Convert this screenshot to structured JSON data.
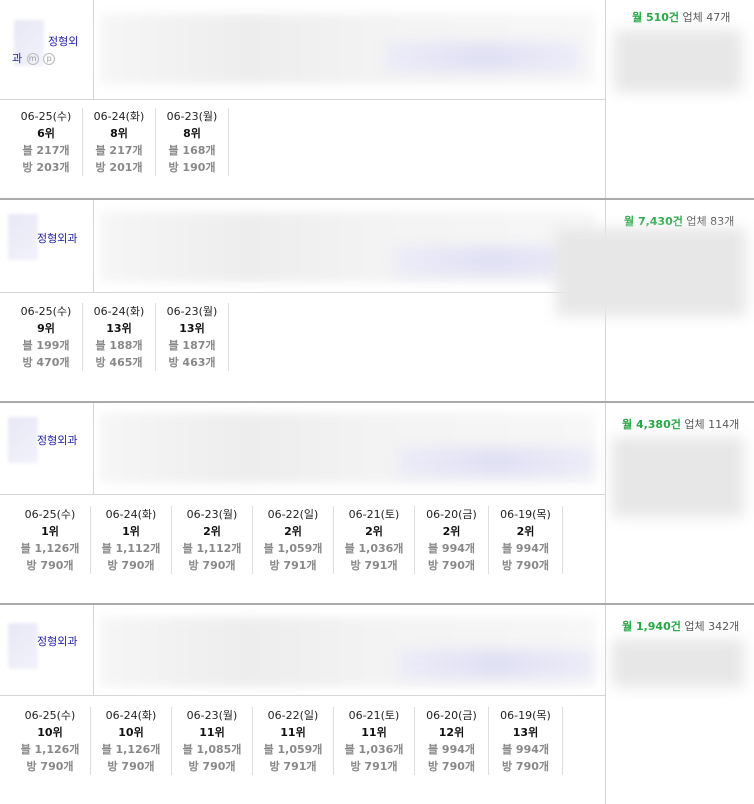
{
  "blocks": [
    {
      "category": "정형외과",
      "category_split": [
        "정형외",
        "과"
      ],
      "badges": [
        "m",
        "p"
      ],
      "stat_month": "월 510건",
      "stat_biz": "업체 47개",
      "days": [
        {
          "date": "06-25(수)",
          "rank": "6위",
          "bul": "블 217개",
          "bang": "방 203개"
        },
        {
          "date": "06-24(화)",
          "rank": "8위",
          "bul": "블 217개",
          "bang": "방 201개"
        },
        {
          "date": "06-23(월)",
          "rank": "8위",
          "bul": "블 168개",
          "bang": "방 190개"
        }
      ]
    },
    {
      "category": "정형외과",
      "stat_month": "월 7,430건",
      "stat_biz": "업체 83개",
      "days": [
        {
          "date": "06-25(수)",
          "rank": "9위",
          "bul": "블 199개",
          "bang": "방 470개"
        },
        {
          "date": "06-24(화)",
          "rank": "13위",
          "bul": "블 188개",
          "bang": "방 465개"
        },
        {
          "date": "06-23(월)",
          "rank": "13위",
          "bul": "블 187개",
          "bang": "방 463개"
        }
      ]
    },
    {
      "category": "정형외과",
      "stat_month": "월 4,380건",
      "stat_biz": "업체 114개",
      "days": [
        {
          "date": "06-25(수)",
          "rank": "1위",
          "bul": "블 1,126개",
          "bang": "방 790개"
        },
        {
          "date": "06-24(화)",
          "rank": "1위",
          "bul": "블 1,112개",
          "bang": "방 790개"
        },
        {
          "date": "06-23(월)",
          "rank": "2위",
          "bul": "블 1,112개",
          "bang": "방 790개"
        },
        {
          "date": "06-22(일)",
          "rank": "2위",
          "bul": "블 1,059개",
          "bang": "방 791개"
        },
        {
          "date": "06-21(토)",
          "rank": "2위",
          "bul": "블 1,036개",
          "bang": "방 791개"
        },
        {
          "date": "06-20(금)",
          "rank": "2위",
          "bul": "블 994개",
          "bang": "방 790개"
        },
        {
          "date": "06-19(목)",
          "rank": "2위",
          "bul": "블 994개",
          "bang": "방 790개"
        }
      ]
    },
    {
      "category": "정형외과",
      "stat_month": "월 1,940건",
      "stat_biz": "업체 342개",
      "days": [
        {
          "date": "06-25(수)",
          "rank": "10위",
          "bul": "블 1,126개",
          "bang": "방 790개"
        },
        {
          "date": "06-24(화)",
          "rank": "10위",
          "bul": "블 1,126개",
          "bang": "방 790개"
        },
        {
          "date": "06-23(월)",
          "rank": "11위",
          "bul": "블 1,085개",
          "bang": "방 790개"
        },
        {
          "date": "06-22(일)",
          "rank": "11위",
          "bul": "블 1,059개",
          "bang": "방 791개"
        },
        {
          "date": "06-21(토)",
          "rank": "11위",
          "bul": "블 1,036개",
          "bang": "방 791개"
        },
        {
          "date": "06-20(금)",
          "rank": "12위",
          "bul": "블 994개",
          "bang": "방 790개"
        },
        {
          "date": "06-19(목)",
          "rank": "13위",
          "bul": "블 994개",
          "bang": "방 790개"
        }
      ]
    }
  ],
  "colors": {
    "month_green": "#1fa83f",
    "category_blue": "#2222aa",
    "muted_gray": "#888888",
    "divider": "#aaaaaa"
  }
}
